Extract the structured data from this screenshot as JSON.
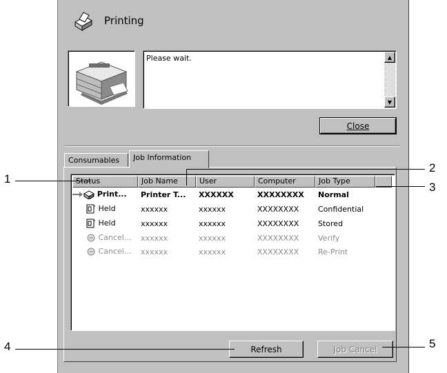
{
  "window": {
    "title": "Printing"
  },
  "message": {
    "text": "Please wait."
  },
  "buttons": {
    "close": "Close",
    "refresh": "Refresh",
    "job_cancel": "Job Cancel"
  },
  "tabs": [
    {
      "label": "Consumables"
    },
    {
      "label": "Job Information",
      "selected": true
    }
  ],
  "table": {
    "columns": [
      "Status",
      "Job Name",
      "User",
      "Computer",
      "Job Type"
    ],
    "rows": [
      {
        "status": "Print...",
        "job_name": "Printer T...",
        "user": "XXXXXX",
        "computer": "XXXXXXXX",
        "job_type": "Normal",
        "style": "bold",
        "icon": "printing-arrow-icon"
      },
      {
        "status": "Held",
        "job_name": "xxxxxx",
        "user": "xxxxxx",
        "computer": "XXXXXXXX",
        "job_type": "Confidential",
        "style": "normal",
        "icon": "held-job-icon"
      },
      {
        "status": "Held",
        "job_name": "xxxxxx",
        "user": "xxxxxx",
        "computer": "XXXXXXXX",
        "job_type": "Stored",
        "style": "normal",
        "icon": "held-job-icon"
      },
      {
        "status": "Cancel...",
        "job_name": "xxxxxx",
        "user": "xxxxxx",
        "computer": "XXXXXXXX",
        "job_type": "Verify",
        "style": "dim",
        "icon": "canceled-job-icon"
      },
      {
        "status": "Cancel...",
        "job_name": "xxxxxx",
        "user": "xxxxxx",
        "computer": "XXXXXXXX",
        "job_type": "Re-Print",
        "style": "dim",
        "icon": "canceled-job-icon"
      }
    ]
  },
  "callouts": [
    "1",
    "2",
    "3",
    "4",
    "5"
  ],
  "colors": {
    "face": "#c0c0c0",
    "shadow": "#808080",
    "disabled_text": "#8c8c8c"
  }
}
